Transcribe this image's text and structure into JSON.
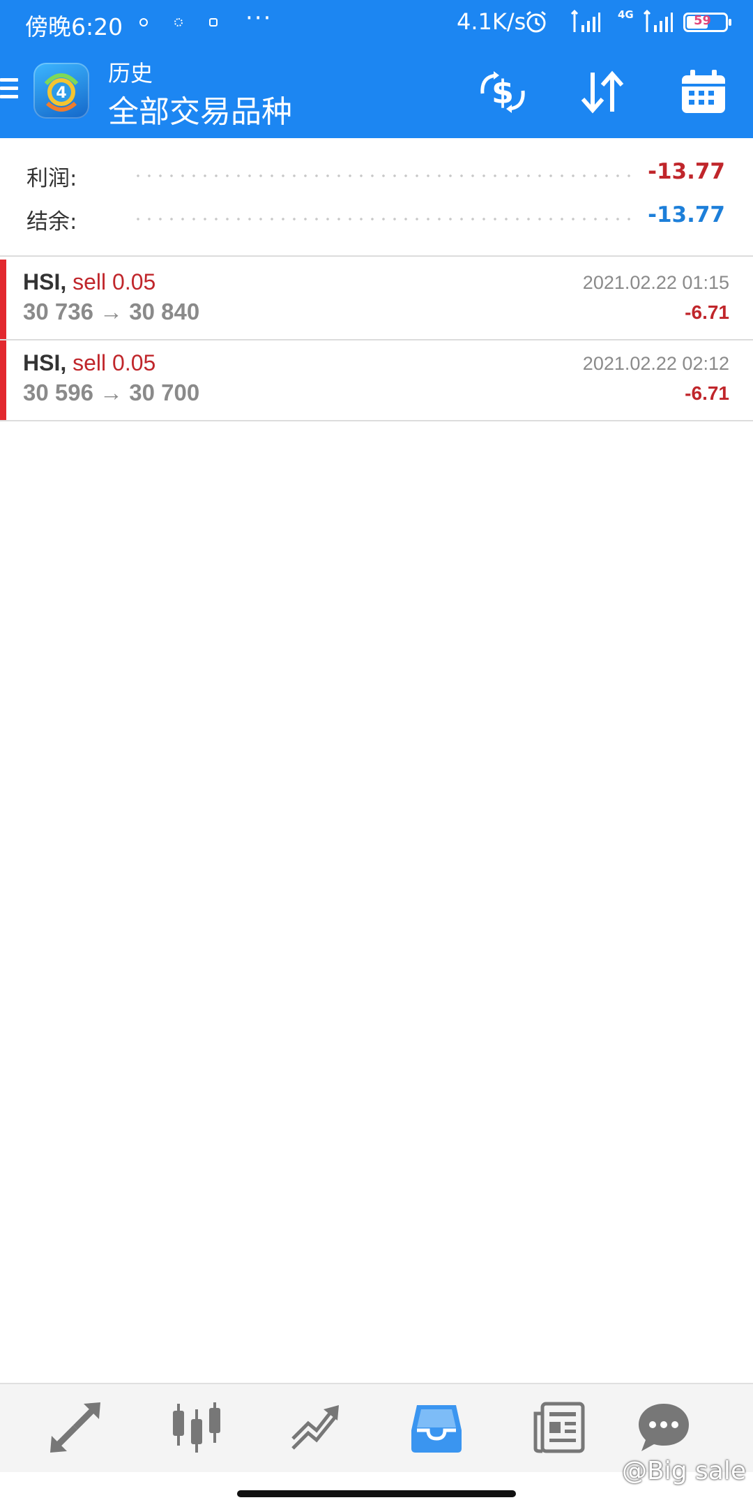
{
  "status_bar": {
    "time": "傍晚6:20",
    "more": "···",
    "net_speed": "4.1K/s",
    "network_type": "4G",
    "battery": "59"
  },
  "app_bar": {
    "section": "历史",
    "filter": "全部交易品种",
    "icons": [
      "menu-icon",
      "app-logo",
      "currency-exchange-icon",
      "sort-icon",
      "calendar-icon"
    ]
  },
  "summary": {
    "profit_label": "利润:",
    "profit_value": "-13.77",
    "balance_label": "结余:",
    "balance_value": "-13.77"
  },
  "deals": [
    {
      "symbol": "HSI,",
      "side": "sell 0.05",
      "open_price": "30 736",
      "arrow": "→",
      "close_price": "30 840",
      "time": "2021.02.22 01:15",
      "profit": "-6.71"
    },
    {
      "symbol": "HSI,",
      "side": "sell 0.05",
      "open_price": "30 596",
      "arrow": "→",
      "close_price": "30 700",
      "time": "2021.02.22 02:12",
      "profit": "-6.71"
    }
  ],
  "bottom_nav": {
    "items": [
      "quotes-icon",
      "chart-icon",
      "trade-icon",
      "history-icon",
      "news-icon",
      "chat-icon"
    ],
    "active": "history-icon"
  },
  "watermark": "@Big sale",
  "colors": {
    "brand": "#1c86f2",
    "loss": "#c0262b",
    "balance": "#1d7fd9",
    "active_nav": "#3a95f0",
    "inactive_nav": "#777777"
  }
}
